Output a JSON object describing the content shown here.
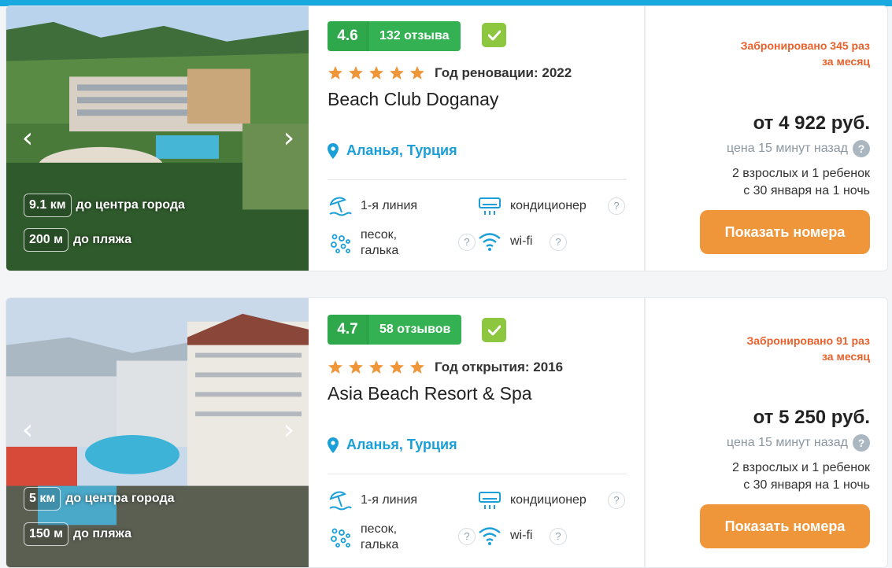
{
  "icons": {
    "prev": "chevron-left-icon",
    "next": "chevron-right-icon",
    "location": "location-pin-icon",
    "check": "check-icon",
    "star": "star-icon",
    "beach": "beach-umbrella-icon",
    "ac": "air-conditioner-icon",
    "sand": "sand-pebble-icon",
    "wifi": "wifi-icon"
  },
  "colors": {
    "accent_blue": "#18a9e0",
    "rating_green": "#2ea84a",
    "check_green": "#8dc63f",
    "star": "#f0963a",
    "booked": "#e8612c",
    "button": "#f0963a"
  },
  "hotels": [
    {
      "rating": "4.6",
      "reviews": "132 отзыва",
      "stars": 5,
      "year_label": "Год реновации: 2022",
      "name": "Beach Club Doganay",
      "location": "Аланья, Турция",
      "dist_center_value": "9.1 км",
      "dist_center_label": "до центра города",
      "dist_beach_value": "200 м",
      "dist_beach_label": "до пляжа",
      "features": {
        "line": "1-я линия",
        "ac": "кондиционер",
        "sand": "песок, галька",
        "wifi": "wi-fi"
      },
      "booked_line1": "Забронировано 345 раз",
      "booked_line2": "за месяц",
      "price": "от 4 922 руб.",
      "price_age": "цена 15 минут назад",
      "guests_line1": "2 взрослых и 1 ребенок",
      "guests_line2": "с 30 января на 1 ночь",
      "button": "Показать номера"
    },
    {
      "rating": "4.7",
      "reviews": "58 отзывов",
      "stars": 5,
      "year_label": "Год открытия: 2016",
      "name": "Asia Beach Resort & Spa",
      "location": "Аланья, Турция",
      "dist_center_value": "5 км",
      "dist_center_label": "до центра города",
      "dist_beach_value": "150 м",
      "dist_beach_label": "до пляжа",
      "features": {
        "line": "1-я линия",
        "ac": "кондиционер",
        "sand": "песок, галька",
        "wifi": "wi-fi"
      },
      "booked_line1": "Забронировано 91 раз",
      "booked_line2": "за месяц",
      "price": "от 5 250 руб.",
      "price_age": "цена 15 минут назад",
      "guests_line1": "2 взрослых и 1 ребенок",
      "guests_line2": "с 30 января на 1 ночь",
      "button": "Показать номера"
    }
  ]
}
